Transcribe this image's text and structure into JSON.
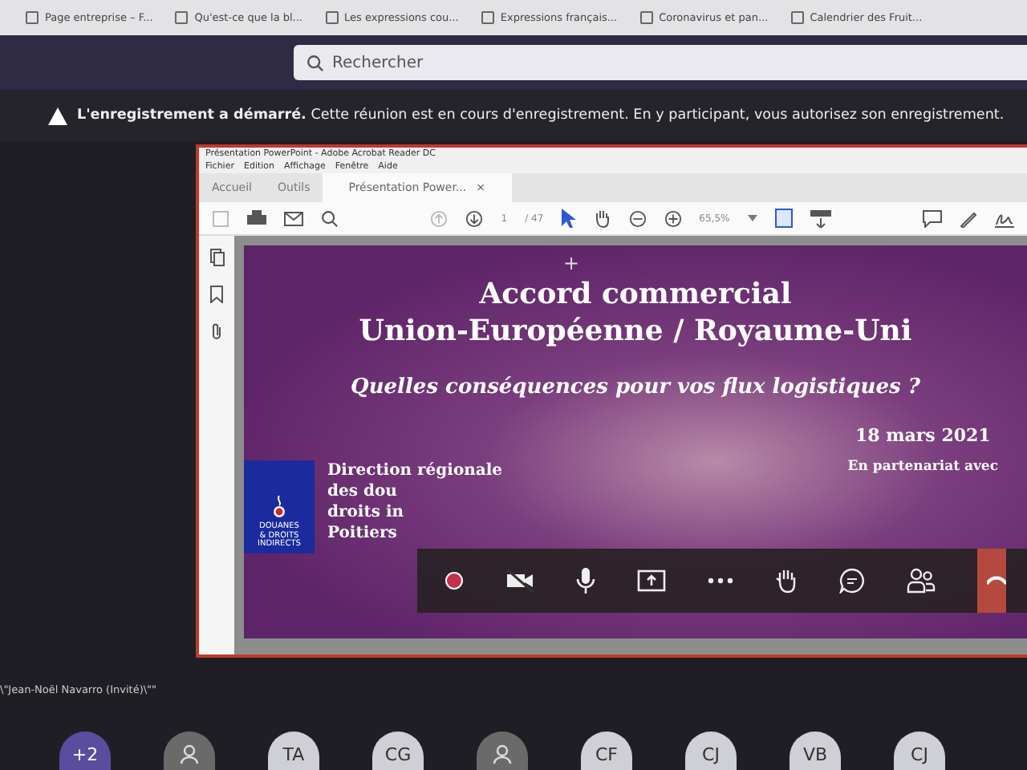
{
  "bookmarks": [
    "Page entreprise – F...",
    "Qu'est-ce que la bl...",
    "Les expressions cou...",
    "Expressions français...",
    "Coronavirus et pan...",
    "Calendrier des Fruit..."
  ],
  "search": {
    "placeholder": "Rechercher"
  },
  "banner": {
    "text": "**L'enregistrement a démarré.** Cette réunion est en cours d'enregistrement. En y participant, vous autorisez son enregistrement."
  },
  "presenter_label": "\\\"Jean-Noël Navarro (Invité)\\\"\"",
  "reader": {
    "title": "Présentation PowerPoint - Adobe Acrobat Reader DC",
    "menu": [
      "Fichier",
      "Edition",
      "Affichage",
      "Fenêtre",
      "Aide"
    ],
    "tabs": [
      {
        "label": "Accueil",
        "selected": false
      },
      {
        "label": "Outils",
        "selected": false
      },
      {
        "label": "Présentation Power...",
        "selected": true,
        "closable": true
      }
    ],
    "close_glyph": "×",
    "page": "1",
    "page_count": "/ 47",
    "zoom": "65,5%"
  },
  "slide": {
    "mark": "+",
    "title": [
      "Accord commercial",
      "Union-Européenne / Royaume-Uni"
    ],
    "subtitle": "Quelles conséquences pour vos flux logistiques ?",
    "date": "18 mars 2021",
    "partner": "En partenariat avec",
    "logo_text": [
      "DOUANES",
      "& DROITS",
      "INDIRECTS"
    ],
    "org": [
      "Direction régionale",
      "des dou",
      "droits in",
      "Poitiers"
    ]
  },
  "call_controls": [
    {
      "kind": "record"
    },
    {
      "kind": "camera",
      "on": false
    },
    {
      "kind": "mic",
      "on": true
    },
    {
      "kind": "share"
    },
    {
      "kind": "more"
    },
    {
      "kind": "hand"
    },
    {
      "kind": "chat"
    },
    {
      "kind": "people"
    },
    {
      "kind": "leave"
    }
  ],
  "participants": [
    {
      "kind": "overflow",
      "label": "+2"
    },
    {
      "kind": "person"
    },
    {
      "kind": "initials",
      "label": "TA"
    },
    {
      "kind": "initials",
      "label": "CG"
    },
    {
      "kind": "person"
    },
    {
      "kind": "initials",
      "label": "CF"
    },
    {
      "kind": "initials",
      "label": "CJ"
    },
    {
      "kind": "initials",
      "label": "VB"
    },
    {
      "kind": "initials",
      "label": "CJ"
    }
  ]
}
